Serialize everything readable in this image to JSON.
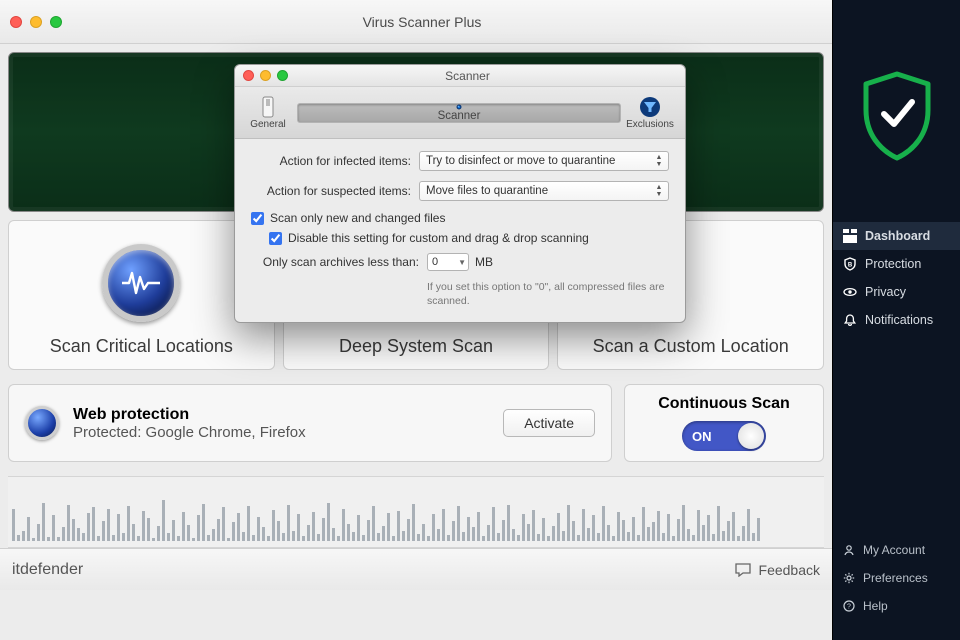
{
  "window": {
    "title": "Virus Scanner Plus"
  },
  "scan_cards": [
    {
      "label": "Scan Critical Locations"
    },
    {
      "label": "Deep System Scan"
    },
    {
      "label": "Scan a Custom Location"
    }
  ],
  "web_protection": {
    "heading": "Web protection",
    "sub": "Protected: Google Chrome, Firefox",
    "activate_label": "Activate"
  },
  "continuous_scan": {
    "heading": "Continuous Scan",
    "state_label": "ON"
  },
  "bottombar": {
    "brand": "itdefender",
    "feedback": "Feedback"
  },
  "modal": {
    "title": "Scanner",
    "tabs": {
      "general": "General",
      "scanner": "Scanner",
      "exclusions": "Exclusions"
    },
    "infected_label": "Action for infected items:",
    "infected_value": "Try to disinfect or move to quarantine",
    "suspected_label": "Action for suspected items:",
    "suspected_value": "Move files to quarantine",
    "scan_only_new": "Scan only new and changed files",
    "disable_custom": "Disable this setting for custom and drag & drop scanning",
    "archives_label": "Only scan archives less than:",
    "archives_value": "0",
    "archives_unit": "MB",
    "hint": "If you set this option to \"0\", all compressed files are scanned."
  },
  "side": {
    "menu": [
      {
        "label": "Dashboard",
        "active": true
      },
      {
        "label": "Protection"
      },
      {
        "label": "Privacy"
      },
      {
        "label": "Notifications"
      }
    ],
    "bottom": [
      {
        "label": "My Account"
      },
      {
        "label": "Preferences"
      },
      {
        "label": "Help"
      }
    ]
  },
  "waveform": [
    55,
    10,
    18,
    42,
    6,
    30,
    66,
    7,
    44,
    7,
    24,
    62,
    38,
    22,
    13,
    48,
    58,
    8,
    34,
    56,
    10,
    46,
    14,
    60,
    30,
    8,
    52,
    40,
    6,
    26,
    70,
    14,
    36,
    9,
    50,
    28,
    6,
    44,
    64,
    11,
    20,
    38,
    58,
    6,
    32,
    48,
    16,
    60,
    10,
    42,
    24,
    8,
    54,
    34,
    14,
    62,
    18,
    46,
    8,
    28,
    50,
    12,
    40,
    66,
    22,
    8,
    56,
    30,
    16,
    44,
    10,
    36,
    60,
    14,
    26,
    48,
    9,
    52,
    18,
    38,
    64,
    12,
    30,
    8,
    46,
    20,
    56,
    10,
    34,
    60,
    16,
    42,
    24,
    50,
    8,
    28,
    58,
    14,
    36,
    62,
    20,
    10,
    46,
    30,
    54,
    12,
    40,
    8,
    26,
    48,
    18,
    62,
    34,
    10,
    56,
    22,
    44,
    14,
    60,
    28,
    8,
    50,
    36,
    16,
    42,
    10,
    58,
    24,
    32,
    52,
    14,
    46,
    8,
    38,
    62,
    20,
    10,
    54,
    28,
    44,
    12,
    60,
    18,
    34,
    50,
    8,
    26,
    56,
    14,
    40
  ]
}
